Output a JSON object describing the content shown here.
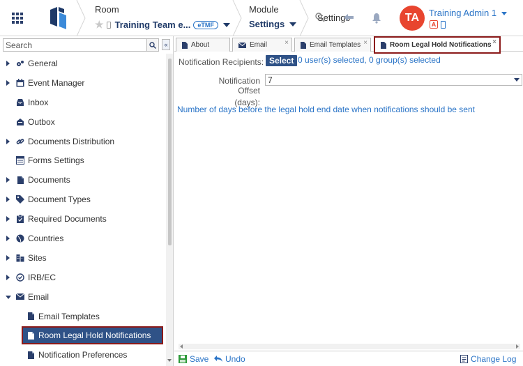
{
  "header": {
    "room_title": "Room",
    "room_value": "Training Team e...",
    "room_badge": "eTMF",
    "module_title": "Module",
    "module_value": "Settings",
    "settings_text": "Settings",
    "avatar_initials": "TA",
    "user_name": "Training Admin 1",
    "user_badge": "A",
    "avatar_color": "#e8452f"
  },
  "sidebar": {
    "search_placeholder": "Search",
    "items": [
      {
        "label": "General",
        "icon": "gears-icon",
        "arrow": "collapsed"
      },
      {
        "label": "Event Manager",
        "icon": "calendar-icon",
        "arrow": "collapsed"
      },
      {
        "label": "Inbox",
        "icon": "inbox-icon",
        "arrow": "none"
      },
      {
        "label": "Outbox",
        "icon": "outbox-icon",
        "arrow": "none"
      },
      {
        "label": "Documents Distribution",
        "icon": "link-icon",
        "arrow": "collapsed"
      },
      {
        "label": "Forms Settings",
        "icon": "form-icon",
        "arrow": "none"
      },
      {
        "label": "Documents",
        "icon": "document-icon",
        "arrow": "collapsed"
      },
      {
        "label": "Document Types",
        "icon": "tag-icon",
        "arrow": "collapsed"
      },
      {
        "label": "Required Documents",
        "icon": "clipboard-icon",
        "arrow": "collapsed"
      },
      {
        "label": "Countries",
        "icon": "globe-icon",
        "arrow": "collapsed"
      },
      {
        "label": "Sites",
        "icon": "building-icon",
        "arrow": "collapsed"
      },
      {
        "label": "IRB/EC",
        "icon": "check-circle-icon",
        "arrow": "collapsed"
      },
      {
        "label": "Email",
        "icon": "envelope-icon",
        "arrow": "expanded"
      },
      {
        "label": "Email Templates",
        "icon": "document-icon",
        "arrow": "child"
      },
      {
        "label": "Room Legal Hold Notifications",
        "icon": "document-icon",
        "arrow": "child-selected"
      },
      {
        "label": "Notification Preferences",
        "icon": "document-icon",
        "arrow": "child"
      }
    ]
  },
  "tabs": [
    {
      "label": "About",
      "icon": "document-icon"
    },
    {
      "label": "Email",
      "icon": "envelope-icon"
    },
    {
      "label": "Email Templates",
      "icon": "document-icon"
    },
    {
      "label": "Room Legal Hold Notifications",
      "icon": "document-icon"
    }
  ],
  "form": {
    "recipients_label": "Notification Recipients:",
    "select_label": "Select",
    "selection_text": "0 user(s) selected, 0 group(s) selected",
    "offset_label_1": "Notification Offset",
    "offset_label_2": "(days):",
    "offset_value": "7",
    "help_text": "Number of days before the legal hold end date when notifications should be sent"
  },
  "footer": {
    "save_label": "Save",
    "undo_label": "Undo",
    "changelog_label": "Change Log"
  },
  "colors": {
    "primary": "#2f5287",
    "link": "#2a74c7",
    "highlight_border": "#8b1a1a"
  }
}
